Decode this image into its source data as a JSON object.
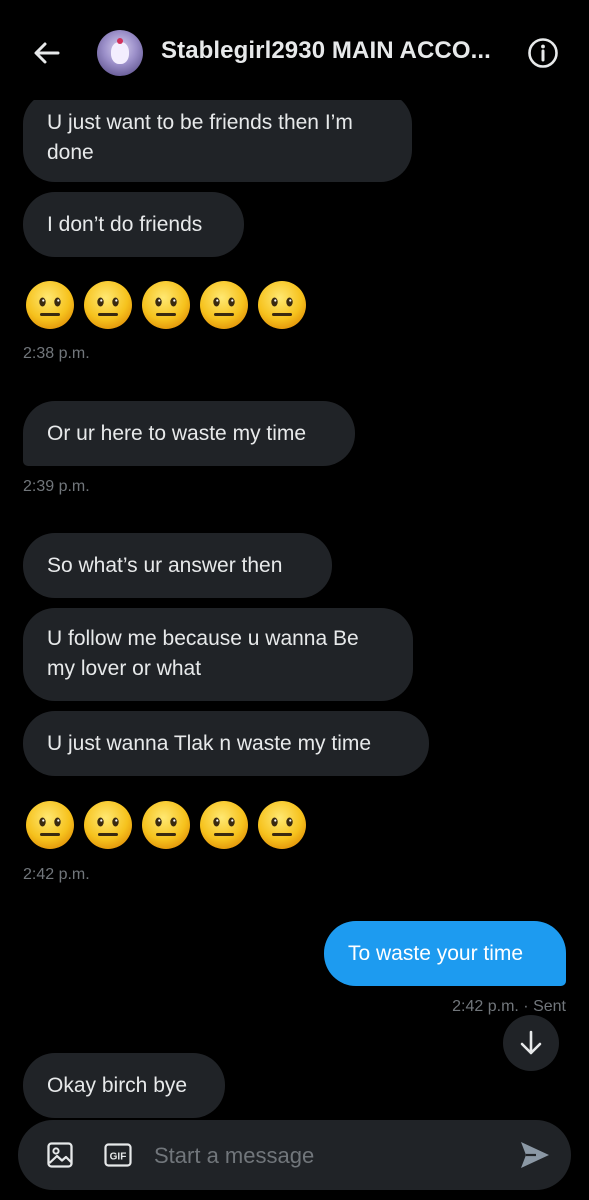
{
  "header": {
    "title": "Stablegirl2930 MAIN ACCO...",
    "back_icon": "back-arrow-icon",
    "info_icon": "info-icon"
  },
  "messages": [
    {
      "text": "U just want to be friends then I’m done",
      "direction": "received"
    },
    {
      "text": "I don’t do friends",
      "direction": "received"
    },
    {
      "emoji": "neutral-face",
      "count": 5,
      "timestamp": "2:38 p.m."
    },
    {
      "text": "Or ur here to waste my time",
      "direction": "received",
      "timestamp": "2:39 p.m."
    },
    {
      "text": "So what’s ur answer then",
      "direction": "received"
    },
    {
      "text": "U follow me because u wanna Be my lover or what",
      "direction": "received"
    },
    {
      "text": "U just wanna Tlak n waste my time",
      "direction": "received"
    },
    {
      "emoji": "neutral-face",
      "count": 5,
      "timestamp": "2:42 p.m."
    },
    {
      "text": "To waste your time",
      "direction": "sent",
      "timestamp": "2:42 p.m. · Sent"
    },
    {
      "text": "Okay birch bye",
      "direction": "received"
    }
  ],
  "composer": {
    "placeholder": "Start a message",
    "value": "",
    "gif_label": "GIF"
  },
  "colors": {
    "background": "#000000",
    "received_bubble": "#202327",
    "sent_bubble": "#1d9bf0",
    "muted_text": "#71767b"
  }
}
